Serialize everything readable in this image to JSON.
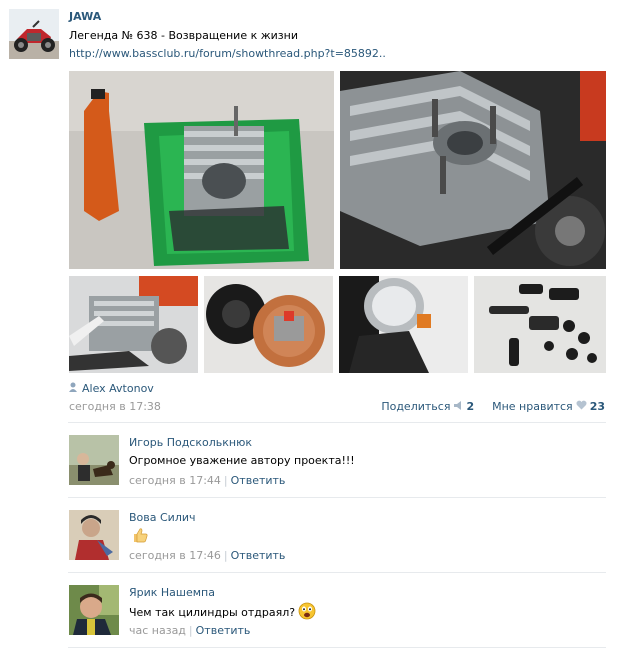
{
  "post": {
    "author": "JAWA",
    "title": "Легенда № 638 - Возвращение к жизни",
    "link": "http://www.bassclub.ru/forum/showthread.php?t=85892..",
    "signed_by": "Alex Avtonov",
    "time": "сегодня в 17:38",
    "share_label": "Поделиться",
    "share_count": "2",
    "like_label": "Мне нравится",
    "like_count": "23"
  },
  "photos": [
    {
      "name": "cylinder-in-green-tub-photo",
      "icon": "photo"
    },
    {
      "name": "engine-head-closeup-photo",
      "icon": "photo"
    },
    {
      "name": "motorcycle-engine-side-photo",
      "icon": "photo"
    },
    {
      "name": "ignition-parts-photo",
      "icon": "photo"
    },
    {
      "name": "headlight-photo",
      "icon": "photo"
    },
    {
      "name": "rubber-parts-photo",
      "icon": "photo"
    }
  ],
  "comments": [
    {
      "author": "Игорь Подсколькнюк",
      "text": "Огромное уважение автору проекта!!!",
      "time": "сегодня в 17:44",
      "reply": "Ответить"
    },
    {
      "author": "Вова Силич",
      "text": "",
      "emoji": "thumbs-up-icon",
      "time": "сегодня в 17:46",
      "reply": "Ответить"
    },
    {
      "author": "Ярик Нашемпа",
      "text": "Чем так цилиндры отдраял?",
      "emoji": "scared-face-icon",
      "time": "час назад",
      "reply": "Ответить"
    }
  ],
  "colors": {
    "link": "#2b587a",
    "meta": "#999999",
    "separator": "#e7eaed"
  }
}
